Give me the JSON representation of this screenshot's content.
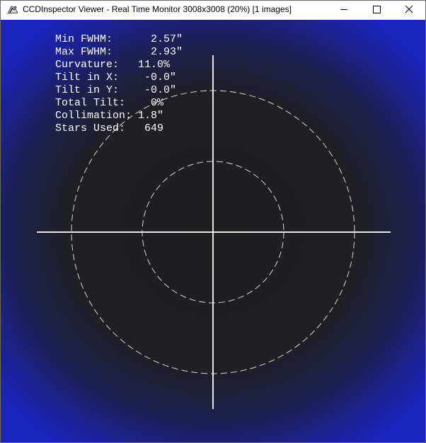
{
  "window": {
    "title": "CCDInspector Viewer - Real Time Monitor 3008x3008 (20%)  [1 images]",
    "icon": "ccdinspector-app-icon",
    "controls": [
      "minimize-icon",
      "maximize-icon",
      "close-icon"
    ]
  },
  "stats": [
    {
      "label": "Min FWHM:      ",
      "value": "2.57\""
    },
    {
      "label": "Max FWHM:      ",
      "value": "2.93\""
    },
    {
      "label": "Curvature:   ",
      "value": "11.0%"
    },
    {
      "label": "Tilt in X:    ",
      "value": "-0.0\""
    },
    {
      "label": "Tilt in Y:    ",
      "value": "-0.0\""
    },
    {
      "label": "Total Tilt:    ",
      "value": "0%"
    },
    {
      "label": "Collimation: ",
      "value": "1.8\""
    },
    {
      "label": "Stars Used:   ",
      "value": "649"
    }
  ],
  "colors": {
    "center_background": "#1f1f22",
    "edge_background": "#1a25c0",
    "crosshair": "#e6e6e6",
    "text": "#ffffff"
  }
}
